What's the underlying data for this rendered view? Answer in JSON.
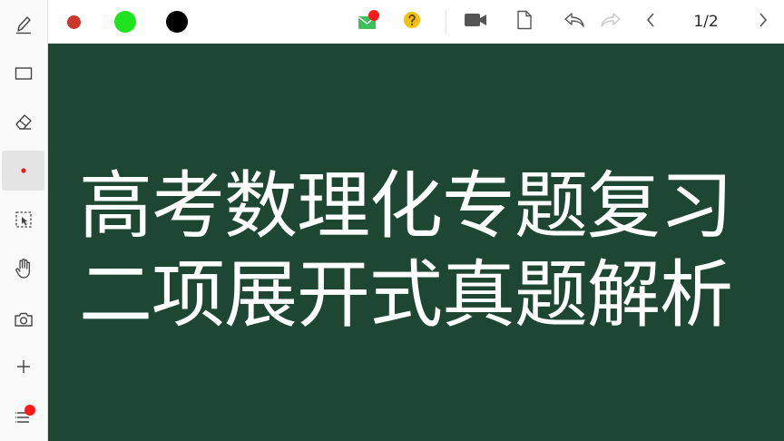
{
  "toolbar_colors": {
    "red": "#c8372a",
    "green": "#1fe31f",
    "black": "#000000"
  },
  "sidebar": {
    "tools": [
      {
        "icon": "pen-icon"
      },
      {
        "icon": "rectangle-icon"
      },
      {
        "icon": "eraser-icon"
      },
      {
        "icon": "laser-pointer-icon",
        "active": true
      },
      {
        "icon": "selection-icon"
      },
      {
        "icon": "hand-icon"
      },
      {
        "icon": "camera-icon"
      },
      {
        "icon": "add-icon"
      },
      {
        "icon": "menu-icon"
      }
    ]
  },
  "topbar": {
    "icons": [
      "message-icon",
      "help-icon",
      "video-icon",
      "file-icon",
      "undo-icon",
      "redo-icon",
      "prev-page-icon",
      "next-page-icon"
    ],
    "page_indicator": "1/2"
  },
  "board": {
    "background": "#1e4733",
    "line1": "高考数理化专题复习",
    "line2": "二项展开式真题解析"
  }
}
